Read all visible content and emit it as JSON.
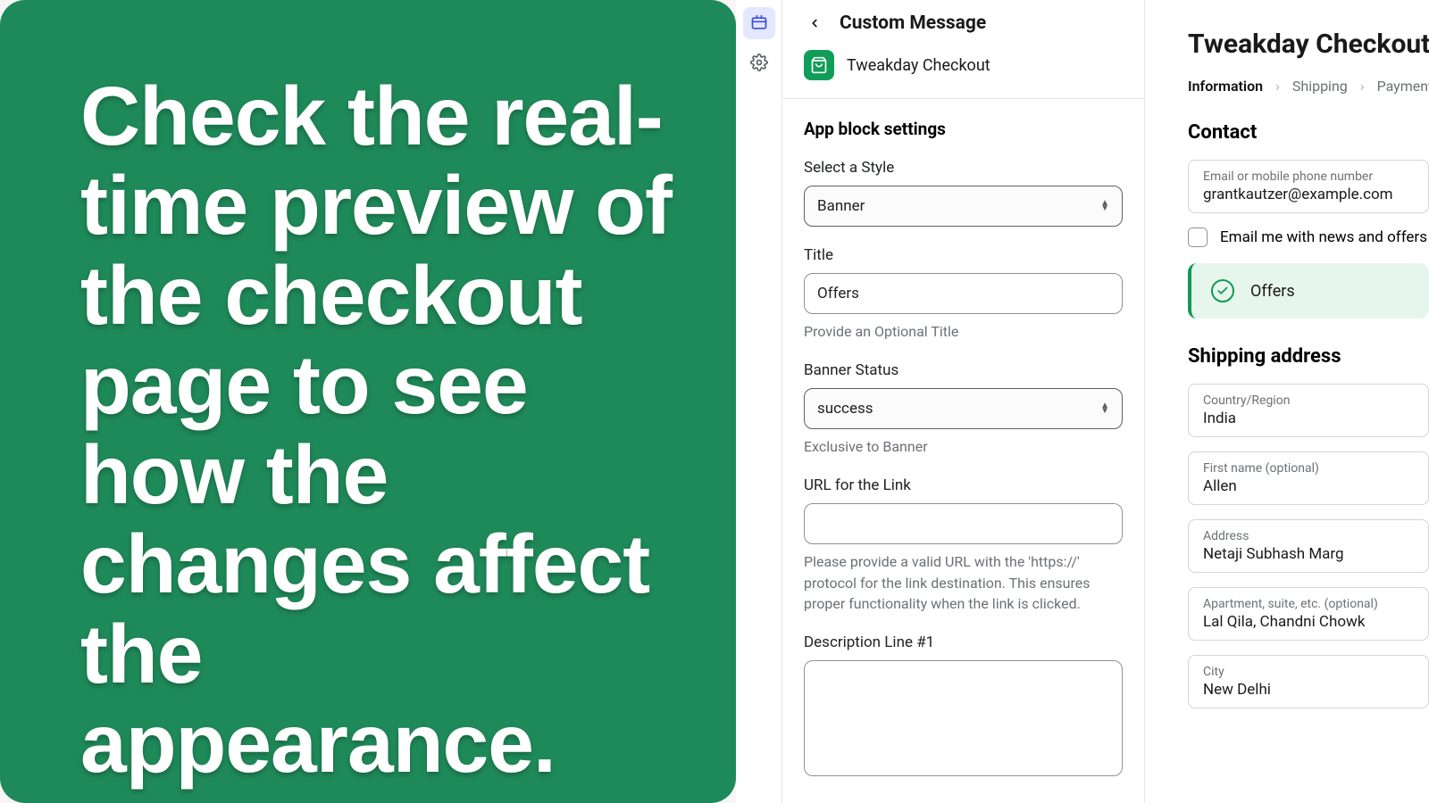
{
  "promo": {
    "text": "Check the real-time preview of the checkout page to see how the changes affect the appearance."
  },
  "rail": {
    "layout_icon": "layout-icon",
    "settings_icon": "gear-icon"
  },
  "settings": {
    "header_title": "Custom Message",
    "app_name": "Tweakday Checkout",
    "section_title": "App block settings",
    "style": {
      "label": "Select a Style",
      "value": "Banner"
    },
    "title_field": {
      "label": "Title",
      "value": "Offers",
      "helper": "Provide an Optional Title"
    },
    "banner_status": {
      "label": "Banner Status",
      "value": "success",
      "helper": "Exclusive to Banner"
    },
    "url": {
      "label": "URL for the Link",
      "value": "",
      "helper": "Please provide a valid URL with the 'https://' protocol for the link destination. This ensures proper functionality when the link is clicked."
    },
    "desc1": {
      "label": "Description Line #1"
    }
  },
  "preview": {
    "store_title": "Tweakday Checkout",
    "breadcrumb": {
      "information": "Information",
      "shipping": "Shipping",
      "payment": "Payment"
    },
    "contact_heading": "Contact",
    "email": {
      "placeholder": "Email or mobile phone number",
      "value": "grantkautzer@example.com"
    },
    "news_checkbox": "Email me with news and offers",
    "banner_label": "Offers",
    "shipping_heading": "Shipping address",
    "country": {
      "placeholder": "Country/Region",
      "value": "India"
    },
    "first_name": {
      "placeholder": "First name (optional)",
      "value": "Allen"
    },
    "address": {
      "placeholder": "Address",
      "value": "Netaji Subhash Marg"
    },
    "apartment": {
      "placeholder": "Apartment, suite, etc. (optional)",
      "value": "Lal Qila, Chandni Chowk"
    },
    "city": {
      "placeholder": "City",
      "value": "New Delhi"
    }
  }
}
